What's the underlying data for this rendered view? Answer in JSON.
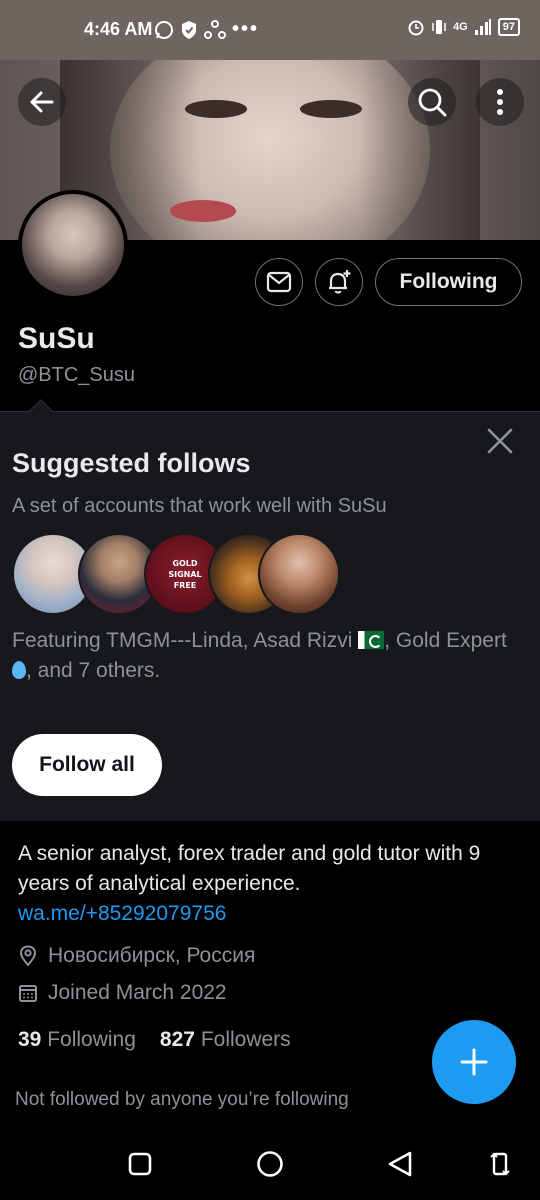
{
  "status_bar": {
    "time": "4:46 AM",
    "battery": "97",
    "network": "4G"
  },
  "header": {
    "back_icon": "arrow-left-icon",
    "search_icon": "search-icon",
    "more_icon": "more-vertical-icon"
  },
  "profile": {
    "display_name": "SuSu",
    "handle": "@BTC_Susu",
    "following_button": "Following",
    "bio_text": "A senior analyst, forex trader and gold tutor with 9 years of analytical experience. ",
    "bio_link": "wa.me/+85292079756",
    "location": "Новосибирск, Россия",
    "joined": "Joined March 2022",
    "following_count": "39",
    "following_label": "Following",
    "followers_count": "827",
    "followers_label": "Followers",
    "not_followed_text": "Not followed by anyone you’re following"
  },
  "suggested": {
    "title": "Suggested follows",
    "subtitle": "A set of accounts that work well with SuSu",
    "featuring_prefix": "Featuring TMGM---Linda, Asad Rizvi ",
    "featuring_middle": ", Gold Expert ",
    "featuring_suffix": ", and 7 others.",
    "follow_all": "Follow all",
    "avatar_badge_text": "GOLD SIGNAL FREE"
  },
  "colors": {
    "accent": "#1d9bf0",
    "background": "#000000",
    "card": "#16181c",
    "muted_text": "#8b9298"
  }
}
